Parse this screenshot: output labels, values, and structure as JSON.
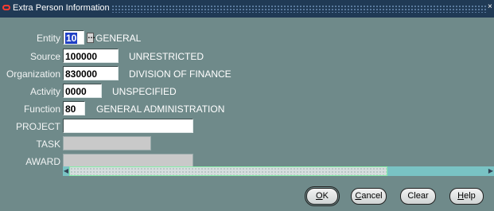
{
  "window": {
    "title": "Extra Person Information"
  },
  "form": {
    "entity": {
      "label": "Entity",
      "value": "10",
      "description": "GENERAL"
    },
    "source": {
      "label": "Source",
      "value": "100000",
      "description": "UNRESTRICTED"
    },
    "organization": {
      "label": "Organization",
      "value": "830000",
      "description": "DIVISION OF FINANCE"
    },
    "activity": {
      "label": "Activity",
      "value": "0000",
      "description": "UNSPECIFIED"
    },
    "function": {
      "label": "Function",
      "value": "80",
      "description": "GENERAL ADMINISTRATION"
    },
    "project": {
      "label": "PROJECT",
      "value": ""
    },
    "task": {
      "label": "TASK",
      "value": ""
    },
    "award": {
      "label": "AWARD",
      "value": ""
    }
  },
  "buttons": {
    "ok": {
      "accel": "O",
      "rest": "K"
    },
    "cancel": {
      "accel": "C",
      "rest": "ancel"
    },
    "clear": {
      "label": "Clear"
    },
    "help": {
      "accel": "H",
      "rest": "elp"
    }
  },
  "icons": {
    "title": "oracle-icon",
    "lov": "list-of-values-icon"
  },
  "colors": {
    "background": "#6f8a8a",
    "titlebar": "#203a55",
    "selection": "#1f3fc5",
    "scroll_track": "#79c3c4"
  }
}
